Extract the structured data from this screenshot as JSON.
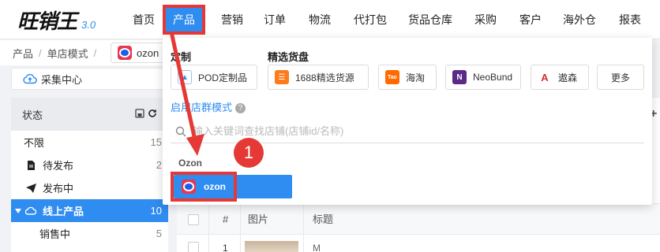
{
  "app": {
    "logo_text": "旺销王",
    "version": "3.0"
  },
  "nav": {
    "items": [
      {
        "label": "首页"
      },
      {
        "label": "产品"
      },
      {
        "label": "营销"
      },
      {
        "label": "订单"
      },
      {
        "label": "物流"
      },
      {
        "label": "代打包"
      },
      {
        "label": "货品仓库"
      },
      {
        "label": "采购"
      },
      {
        "label": "客户"
      },
      {
        "label": "海外仓"
      },
      {
        "label": "报表"
      }
    ],
    "active_index": 1
  },
  "breadcrumb": {
    "items": [
      "产品",
      "单店模式"
    ],
    "separator": "/"
  },
  "shop_tab": {
    "label": "ozon"
  },
  "collect_center": {
    "label": "采集中心"
  },
  "sidebar": {
    "header": "状态",
    "items": [
      {
        "label": "不限",
        "count": "15"
      },
      {
        "label": "待发布",
        "count": "2"
      },
      {
        "label": "发布中",
        "count": ""
      },
      {
        "label": "线上产品",
        "count": "10"
      },
      {
        "label": "销售中",
        "count": "5"
      }
    ]
  },
  "table": {
    "headers": {
      "index": "#",
      "image": "图片",
      "title": "标题"
    },
    "first_row": {
      "index": "1",
      "title_partial": "M"
    }
  },
  "popup": {
    "custom_title": "定制",
    "selected_title": "精选货盘",
    "chips": [
      {
        "label": "POD定制品",
        "icon": "shirt-icon"
      },
      {
        "label": "1688精选货源",
        "icon": "1688-icon"
      },
      {
        "label": "海淘",
        "icon": "taobao-icon"
      },
      {
        "label": "NeoBund",
        "icon": "neobund-icon"
      },
      {
        "label": "遨森",
        "icon": "aosom-icon"
      },
      {
        "label": "更多",
        "icon": ""
      }
    ],
    "mode_link": "启用店群模式",
    "search_placeholder": "输入关键词查找店铺(店铺id/名称)",
    "platform_label": "Ozon",
    "shop_button_label": "ozon"
  },
  "annotation": {
    "step": "1"
  },
  "colors": {
    "accent": "#2f8cf0",
    "highlight": "#e53935"
  }
}
